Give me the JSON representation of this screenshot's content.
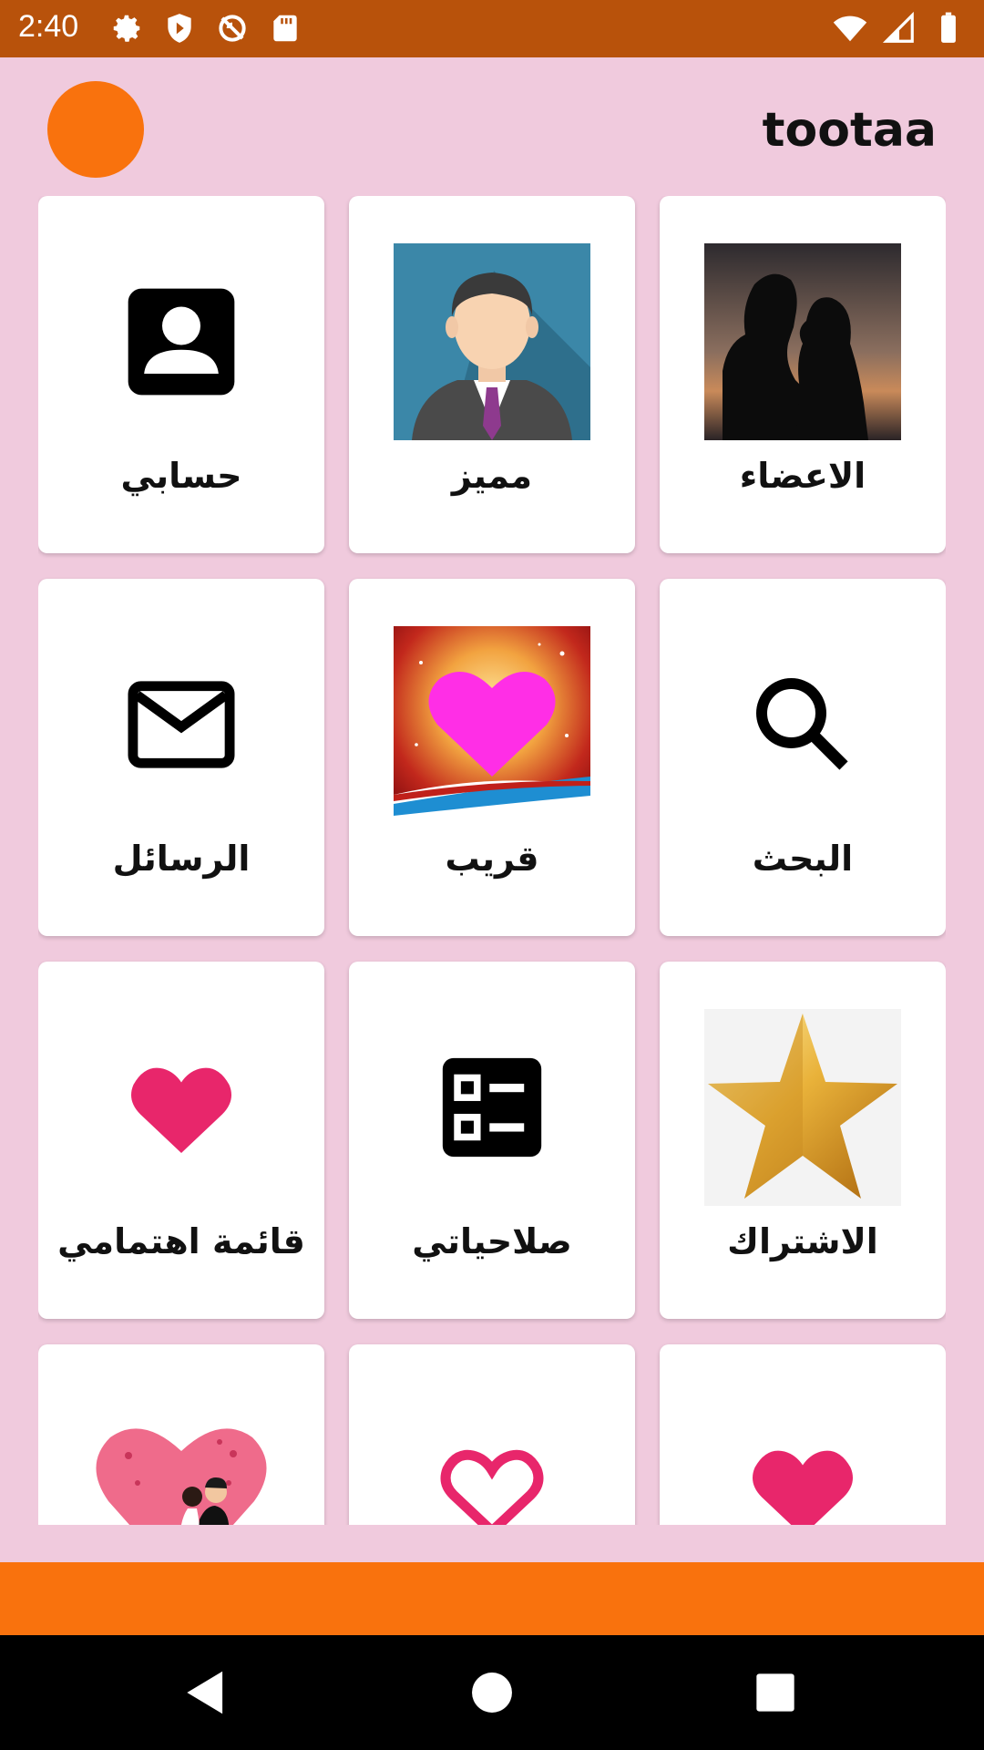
{
  "status": {
    "time": "2:40",
    "left_icons": [
      "gear-icon",
      "shield-icon",
      "no-sync-icon",
      "sd-card-icon"
    ],
    "right_icons": [
      "wifi-icon",
      "signal-icon",
      "battery-icon"
    ]
  },
  "header": {
    "title": "tootaa"
  },
  "tiles": [
    {
      "label": "الاعضاء",
      "icon": "couple-photo-icon"
    },
    {
      "label": "مميز",
      "icon": "businessman-icon"
    },
    {
      "label": "حسابي",
      "icon": "account-box-icon"
    },
    {
      "label": "البحث",
      "icon": "search-icon"
    },
    {
      "label": "قريب",
      "icon": "heart-card-icon"
    },
    {
      "label": "الرسائل",
      "icon": "mail-icon"
    },
    {
      "label": "الاشتراك",
      "icon": "gold-star-icon"
    },
    {
      "label": "صلاحياتي",
      "icon": "checklist-icon"
    },
    {
      "label": "قائمة اهتمامي",
      "icon": "heart-icon"
    },
    {
      "label": "",
      "icon": "heart-icon"
    },
    {
      "label": "",
      "icon": "heart-outline-icon"
    },
    {
      "label": "",
      "icon": "wedding-couple-icon"
    }
  ],
  "colors": {
    "status_bar": "#b8520b",
    "background": "#f0cadd",
    "accent": "#f9720d",
    "heart": "#e8266b",
    "nav_bar": "#000000"
  },
  "nav": [
    "back-icon",
    "home-icon",
    "recents-icon"
  ]
}
